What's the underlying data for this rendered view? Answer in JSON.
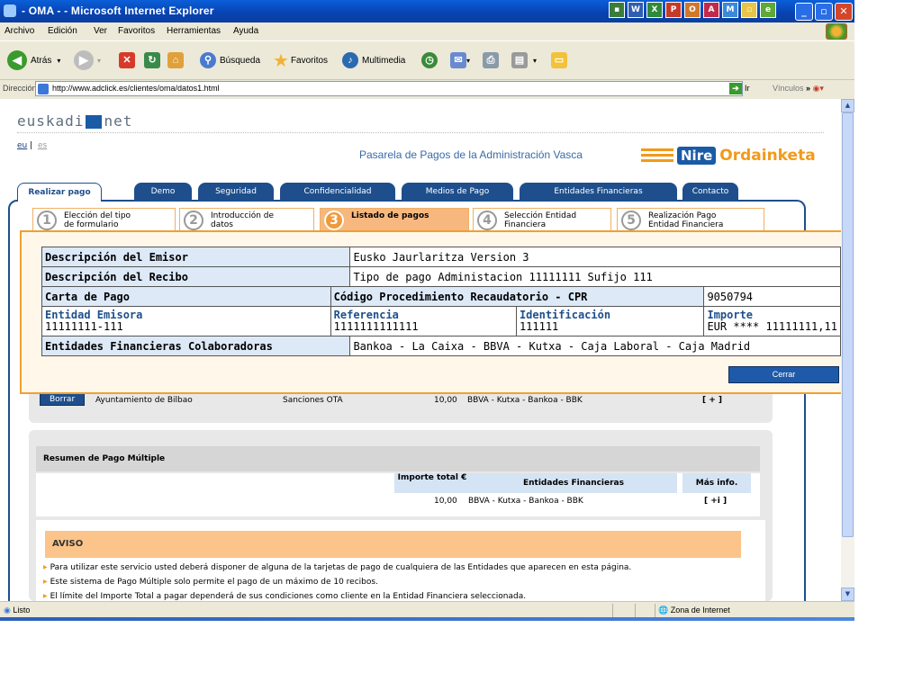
{
  "window": {
    "title": "- OMA - - Microsoft Internet Explorer"
  },
  "menu": [
    "Archivo",
    "Edición",
    "Ver",
    "Favoritos",
    "Herramientas",
    "Ayuda"
  ],
  "toolbar": {
    "back": "Atrás",
    "search": "Búsqueda",
    "favorites": "Favoritos",
    "multimedia": "Multimedia"
  },
  "address": {
    "label": "Dirección",
    "url": "http://www.adclick.es/clientes/oma/datos1.html",
    "go": "Ir",
    "links": "Vínculos"
  },
  "status": {
    "text": "Listo",
    "zone": "Zona de Internet"
  },
  "page": {
    "logo": "euskadi.net",
    "lang_eu": "eu",
    "lang_es": "es",
    "header": "Pasarela de Pagos de la Administración Vasca",
    "brand_nire": "Nire",
    "brand_ord": "Ordainketa",
    "tabs": [
      "Realizar pago",
      "Demo",
      "Seguridad",
      "Confidencialidad",
      "Medios de Pago",
      "Entidades Financieras",
      "Contacto"
    ],
    "steps": [
      {
        "num": "1",
        "l1": "Elección del tipo",
        "l2": "de formulario"
      },
      {
        "num": "2",
        "l1": "Introducción de",
        "l2": "datos"
      },
      {
        "num": "3",
        "l1": "Listado de pagos",
        "l2": ""
      },
      {
        "num": "4",
        "l1": "Selección Entidad",
        "l2": "Financiera"
      },
      {
        "num": "5",
        "l1": "Realización Pago",
        "l2": "Entidad Financiera"
      }
    ],
    "row": {
      "button": "Borrar",
      "entity": "Ayuntamiento de Bilbao",
      "concept": "Sanciones OTA",
      "amount": "10,00",
      "banks": "BBVA - Kutxa - Bankoa - BBK",
      "more": "[ + ]"
    },
    "summary": {
      "title": "Resumen de Pago Múltiple",
      "col_total": "Importe total €",
      "col_entities": "Entidades Financieras",
      "col_more": "Más info.",
      "total": "10,00",
      "banks": "BBVA - Kutxa - Bankoa - BBK",
      "more": "[ +i ]"
    },
    "aviso": {
      "title": "AVISO",
      "items": [
        "Para utilizar este servicio usted deberá disponer de alguna de la tarjetas de pago de cualquiera de las Entidades que aparecen en esta página.",
        "Este sistema de Pago Múltiple solo permite el pago de un máximo de 10 recibos.",
        "El límite del Importe Total a pagar dependerá de sus condiciones como cliente en la Entidad Financiera seleccionada."
      ]
    }
  },
  "modal": {
    "emisor_label": "Descripción del Emisor",
    "emisor_value": "Eusko Jaurlaritza Version 3",
    "recibo_label": "Descripción del Recibo",
    "recibo_value": "Tipo de pago Administacion 11111111 Sufijo 111",
    "carta_label": "Carta de Pago",
    "cpr_label": "Código Procedimiento Recaudatorio - CPR",
    "cpr_value": "9050794",
    "entidad_label": "Entidad Emisora",
    "entidad_value": "11111111-111",
    "referencia_label": "Referencia",
    "referencia_value": "1111111111111",
    "identificacion_label": "Identificación",
    "identificacion_value": "111111",
    "importe_label": "Importe",
    "importe_value": "EUR **** 11111111,11",
    "colab_label": "Entidades Financieras Colaboradoras",
    "colab_value": "Bankoa - La Caixa - BBVA - Kutxa - Caja Laboral - Caja Madrid",
    "close": "Cerrar"
  }
}
